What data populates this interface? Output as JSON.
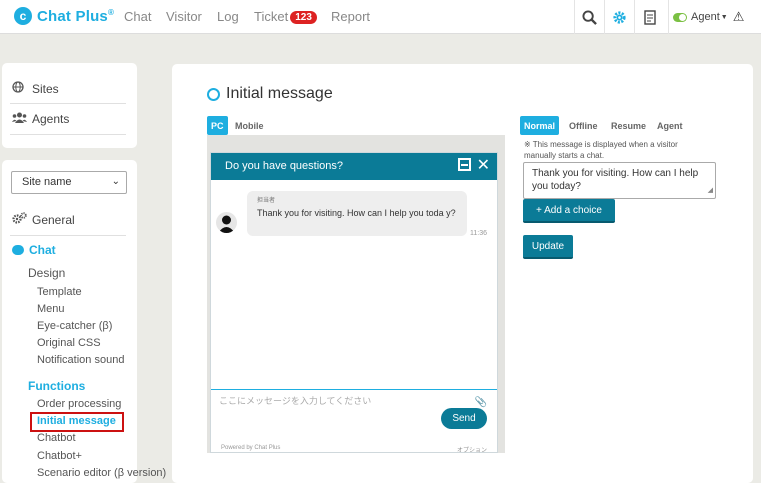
{
  "header": {
    "logo_text": "Chat Plus",
    "logo_mark": "®",
    "nav": [
      "Chat",
      "Visitor",
      "Log",
      "Ticket",
      "Report"
    ],
    "ticket_count": "123",
    "agent_label": "Agent",
    "status_color": "#7bc043"
  },
  "sidebar": {
    "top_links": [
      "Sites",
      "Agents"
    ],
    "site_select": "Site name",
    "general_label": "General",
    "chat_label": "Chat",
    "design_label": "Design",
    "design_items": [
      "Template",
      "Menu",
      "Eye-catcher (β)",
      "Original CSS",
      "Notification sound"
    ],
    "functions_label": "Functions",
    "function_items": [
      "Order processing",
      "Initial message",
      "Chatbot",
      "Chatbot+",
      "Scenario editor (β version)"
    ]
  },
  "main": {
    "title": "Initial message",
    "device_tabs": [
      "PC",
      "Mobile"
    ],
    "mode_tabs": [
      "Normal",
      "Offline",
      "Resume",
      "Agent"
    ],
    "widget": {
      "header_title": "Do you have questions?",
      "agent_name": "担当者",
      "message": "Thank you for visiting. How can I help you toda y?",
      "time": "11:36",
      "input_placeholder": "ここにメッセージを入力してください",
      "send_label": "Send",
      "powered_by": "Powered by Chat Plus",
      "option_label": "オプション"
    },
    "note": "※ This message is displayed when a visitor manually starts a chat.",
    "message_value": "Thank you for visiting. How can I help you today?",
    "add_choice_label": "+ Add a choice",
    "update_label": "Update"
  },
  "colors": {
    "accent": "#1eaee0",
    "brand_dark": "#0b7b97",
    "highlight_border": "#cc1111"
  }
}
